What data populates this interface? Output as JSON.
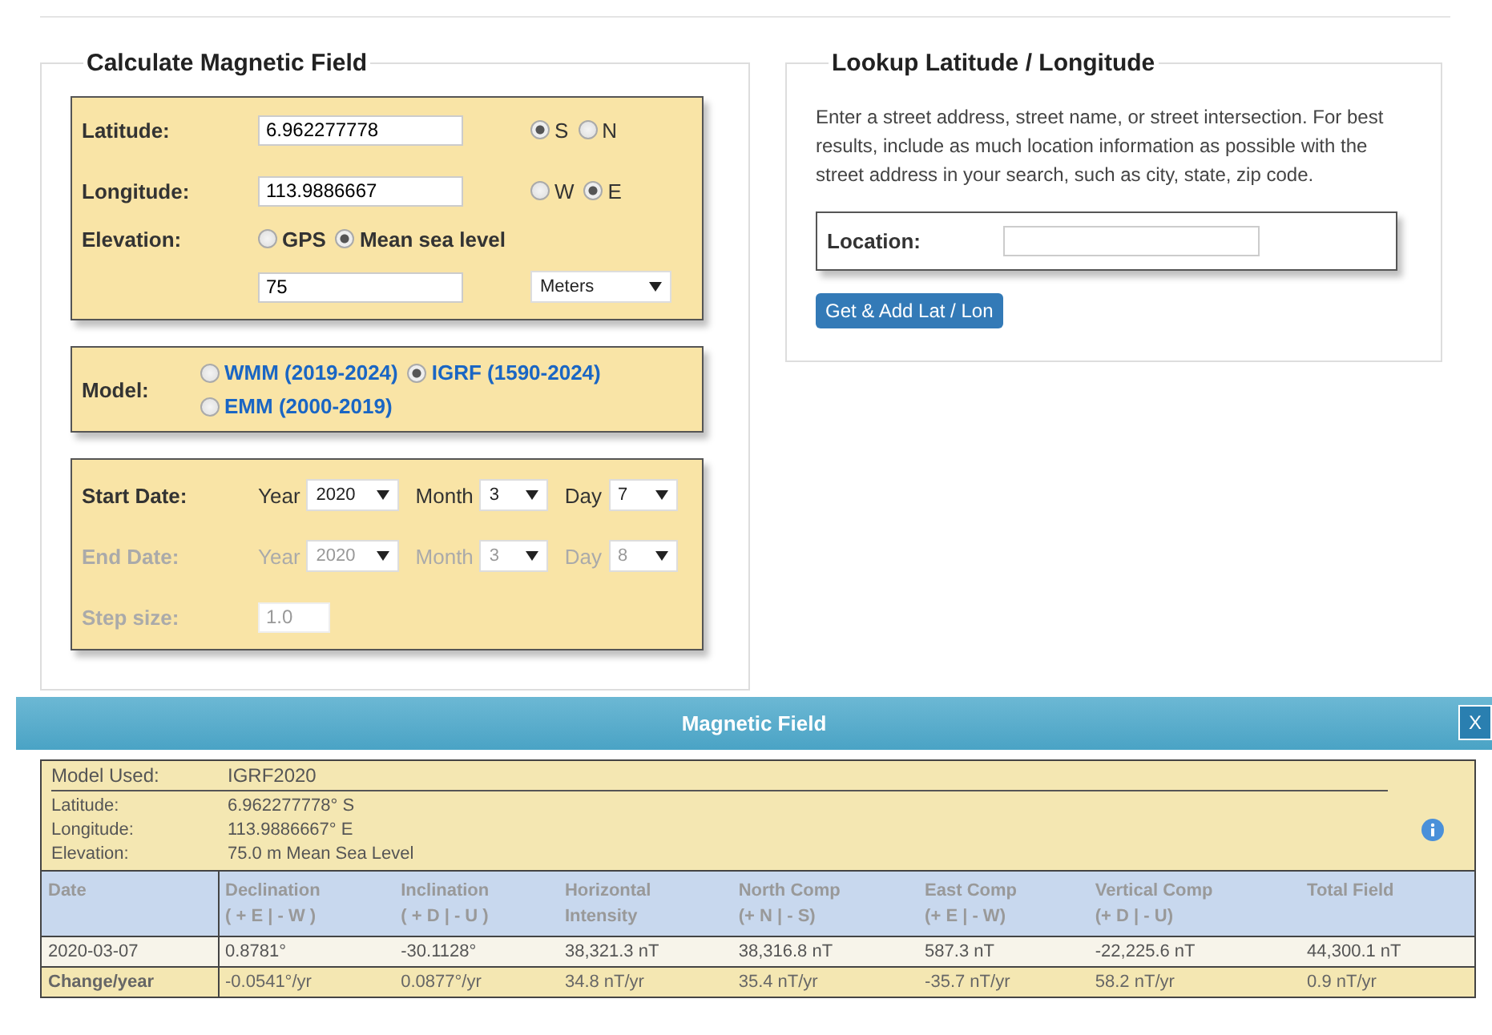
{
  "calculate": {
    "title": "Calculate Magnetic Field",
    "latitude": {
      "label": "Latitude:",
      "value": "6.962277778",
      "options": [
        {
          "label": "S",
          "selected": true
        },
        {
          "label": "N",
          "selected": false
        }
      ]
    },
    "longitude": {
      "label": "Longitude:",
      "value": "113.9886667",
      "options": [
        {
          "label": "W",
          "selected": false
        },
        {
          "label": "E",
          "selected": true
        }
      ]
    },
    "elevation": {
      "label": "Elevation:",
      "options": [
        {
          "label": "GPS",
          "selected": false
        },
        {
          "label": "Mean sea level",
          "selected": true
        }
      ],
      "value": "75",
      "unit": "Meters"
    },
    "model": {
      "label": "Model:",
      "options": [
        {
          "label": "WMM (2019-2024)",
          "selected": false
        },
        {
          "label": "IGRF (1590-2024)",
          "selected": true
        },
        {
          "label": "EMM (2000-2019)",
          "selected": false
        }
      ]
    },
    "dates": [
      {
        "label": "Start Date:",
        "disabled": false,
        "parts": [
          {
            "label": "Year",
            "value": "2020"
          },
          {
            "label": "Month",
            "value": "3"
          },
          {
            "label": "Day",
            "value": "7"
          }
        ]
      },
      {
        "label": "End Date:",
        "disabled": true,
        "parts": [
          {
            "label": "Year",
            "value": "2020"
          },
          {
            "label": "Month",
            "value": "3"
          },
          {
            "label": "Day",
            "value": "8"
          }
        ]
      }
    ],
    "step": {
      "label": "Step size:",
      "value": "1.0",
      "disabled": true
    }
  },
  "lookup": {
    "title": "Lookup Latitude / Longitude",
    "description": "Enter a street address, street name, or street intersection. For best results, include as much location information as possible with the street address in your search, such as city, state, zip code.",
    "location_label": "Location:",
    "button": "Get & Add Lat / Lon"
  },
  "dialog": {
    "title": "Magnetic Field",
    "close": "X",
    "info": [
      {
        "label": "Model Used:",
        "value": "IGRF2020"
      },
      {
        "label": "Latitude:",
        "value": "6.962277778° S"
      },
      {
        "label": "Longitude:",
        "value": "113.9886667° E"
      },
      {
        "label": "Elevation:",
        "value": "75.0 m Mean Sea Level"
      }
    ],
    "columns": [
      {
        "title": "Date"
      },
      {
        "title": "Declination",
        "sub": "( + E  | - W )"
      },
      {
        "title": "Inclination",
        "sub": "( + D  | - U )"
      },
      {
        "title": "Horizontal",
        "sub": "Intensity"
      },
      {
        "title": "North Comp",
        "sub": "(+ N  | - S)"
      },
      {
        "title": "East Comp",
        "sub": "(+ E  | - W)"
      },
      {
        "title": "Vertical Comp",
        "sub": "(+ D  | - U)"
      },
      {
        "title": "Total Field"
      }
    ],
    "rows": [
      {
        "kind": "value",
        "cells": [
          "2020-03-07",
          "0.8781°",
          "-30.1128°",
          "38,321.3 nT",
          "38,316.8 nT",
          "587.3 nT",
          "-22,225.6 nT",
          "44,300.1 nT"
        ]
      },
      {
        "kind": "change",
        "cells": [
          "Change/year",
          "-0.0541°/yr",
          "0.0877°/yr",
          "34.8 nT/yr",
          "35.4 nT/yr",
          "-35.7 nT/yr",
          "58.2 nT/yr",
          "0.9 nT/yr"
        ]
      }
    ]
  }
}
